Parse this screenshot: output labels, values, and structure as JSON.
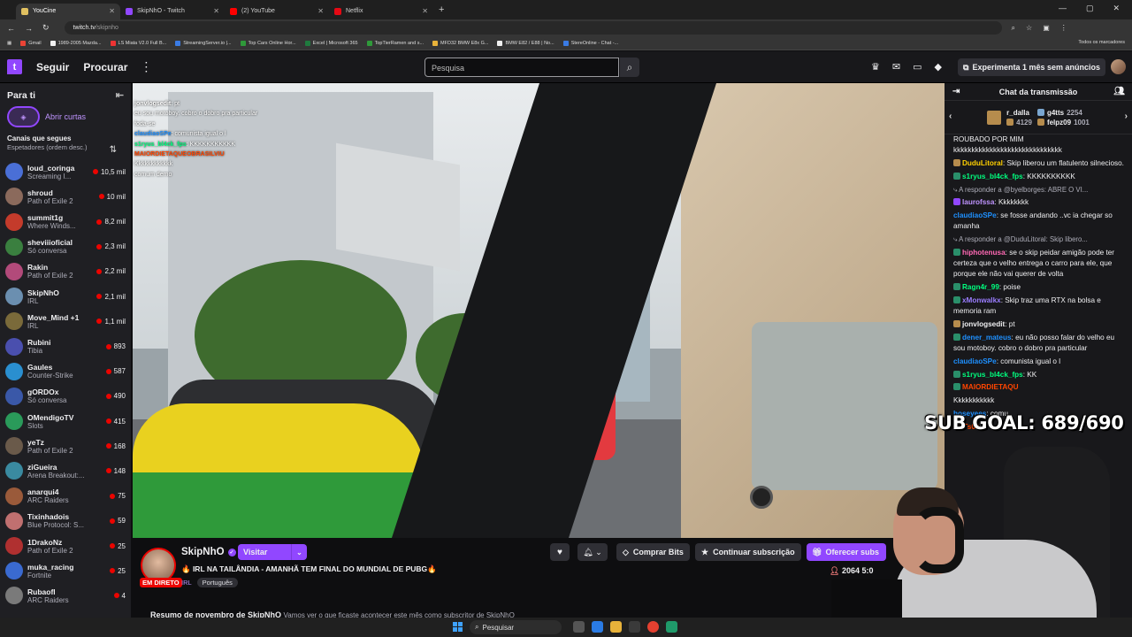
{
  "browser": {
    "tabs": [
      {
        "title": "YouCine",
        "color": "#e0c060",
        "active": true
      },
      {
        "title": "SkipNhO - Twitch",
        "color": "#9147ff",
        "active": false
      },
      {
        "title": "(2) YouTube",
        "color": "#ff0000",
        "active": false
      },
      {
        "title": "Netflix",
        "color": "#e50914",
        "active": false
      }
    ],
    "url_host": "twitch.tv",
    "url_path": "/skipnho",
    "bookmarks": [
      "Gmail",
      "1989-2005 Mazda...",
      "LS Miata V2.0 Full B...",
      "StreamingServer.io |...",
      "Top Cars Online Hor...",
      "Excel | Microsoft 365",
      "TopTierRamen and s...",
      "MFD32 BMW E8x G...",
      "BMW E82 / E88 | No...",
      "StereOnline - Chat -..."
    ],
    "bookmarks_all": "Todos os marcadores"
  },
  "topnav": {
    "follow": "Seguir",
    "browse": "Procurar",
    "search_placeholder": "Pesquisa",
    "promo": "Experimenta 1 mês sem anúncios"
  },
  "sidebar": {
    "title": "Para ti",
    "shorts": "Abrir curtas",
    "section": "Canais que segues",
    "sort": "Espetadores (ordem desc.)",
    "channels": [
      {
        "name": "loud_coringa",
        "game": "Screaming I...",
        "viewers": "10,5 mil",
        "color": "#4a6fd6"
      },
      {
        "name": "shroud",
        "game": "Path of Exile 2",
        "viewers": "10 mil",
        "color": "#8b6a5c"
      },
      {
        "name": "summit1g",
        "game": "Where Winds...",
        "viewers": "8,2 mil",
        "color": "#c43b2b"
      },
      {
        "name": "sheviiioficial",
        "game": "Só conversa",
        "viewers": "2,3 mil",
        "color": "#3a7f3f"
      },
      {
        "name": "Rakin",
        "game": "Path of Exile 2",
        "viewers": "2,2 mil",
        "color": "#b24a7a"
      },
      {
        "name": "SkipNhO",
        "game": "IRL",
        "viewers": "2,1 mil",
        "color": "#6b8fb0"
      },
      {
        "name": "Move_Mind +1",
        "game": "IRL",
        "viewers": "1,1 mil",
        "color": "#7a6a3a"
      },
      {
        "name": "Rubini",
        "game": "Tibia",
        "viewers": "893",
        "color": "#4a4fae"
      },
      {
        "name": "Gaules",
        "game": "Counter-Strike",
        "viewers": "587",
        "color": "#2a8fd0"
      },
      {
        "name": "gORDOx",
        "game": "Só conversa",
        "viewers": "490",
        "color": "#3a58a8"
      },
      {
        "name": "OMendigoTV",
        "game": "Slots",
        "viewers": "415",
        "color": "#2a9a5a"
      },
      {
        "name": "yeTz",
        "game": "Path of Exile 2",
        "viewers": "168",
        "color": "#6a5a4a"
      },
      {
        "name": "ziGueira",
        "game": "Arena Breakout:...",
        "viewers": "148",
        "color": "#3a8aa0"
      },
      {
        "name": "anarqui4",
        "game": "ARC Raiders",
        "viewers": "75",
        "color": "#9a5a3a"
      },
      {
        "name": "Tixinhadois",
        "game": "Blue Protocol: S...",
        "viewers": "59",
        "color": "#c07070"
      },
      {
        "name": "1DrakoNz",
        "game": "Path of Exile 2",
        "viewers": "25",
        "color": "#b03030"
      },
      {
        "name": "muka_racing",
        "game": "Fortnite",
        "viewers": "25",
        "color": "#3a6ad0"
      },
      {
        "name": "Rubaofl",
        "game": "ARC Raiders",
        "viewers": "4",
        "color": "#7a7a7a"
      }
    ]
  },
  "overlay_chat": [
    {
      "user": "jonvlogsedit",
      "text": ": pt"
    },
    {
      "user": "",
      "text": "eu sou motoboy. cobro o dobro pra particular"
    },
    {
      "user": "",
      "text": "foda-se"
    },
    {
      "user": "claudiaoSPe",
      "text": ": comunista igual o l"
    },
    {
      "user": "s1ryus_bl4ck_fps",
      "text": ": KKKKKKKKKKK"
    },
    {
      "user": "MAIORDIETAQUEOBRASILVIU",
      "text": ""
    },
    {
      "user": "",
      "text": "Kkkkkkkkkkkk"
    },
    {
      "user": "",
      "text": "comum demo"
    }
  ],
  "stream": {
    "streamer": "SkipNhO",
    "visit": "Visitar",
    "live": "EM DIRETO",
    "title": "🔥 IRL NA TAILÂNDIA - AMANHÃ TEM FINAL DO MUNDIAL DE PUBG🔥",
    "category": "IRL",
    "tag": "Português",
    "bits": "Comprar Bits",
    "continue_sub": "Continuar subscrição",
    "gift": "Oferecer subs",
    "viewers": "2064",
    "uptime": "5:0",
    "summary_title": "Resumo de novembro de SkipNhO",
    "summary_text": "Vamos ver o que ficaste acontecer este mês como subscritor de SkipNhO"
  },
  "chat": {
    "title": "Chat da transmissão",
    "leaderboard": [
      {
        "name": "r_dalla",
        "score": "4129"
      },
      {
        "name": "g4tts",
        "score": "2254"
      },
      {
        "name": "felpz09",
        "score": "1001"
      }
    ],
    "messages": [
      {
        "user": "",
        "text": "ROUBADO POR MIM kkkkkkkkkkkkkkkkkkkkkkkkkkkkkk",
        "color": "#efeff1",
        "badge": ""
      },
      {
        "user": "DuduLitoral",
        "text": ": Skip liberou um flatulento silnecioso.",
        "color": "#ffd000",
        "badge": "#b68c4d"
      },
      {
        "user": "s1ryus_bl4ck_fps",
        "text": ": KKKKKKKKKK",
        "color": "#00ff7f",
        "badge": "#2a8f6a"
      },
      {
        "reply": "A responder a @byelborges: ABRE O VI..."
      },
      {
        "user": "laurofssa",
        "text": ": Kkkkkkkk",
        "color": "#bf94ff",
        "badge": "#9147ff"
      },
      {
        "user": "claudiaoSPe",
        "text": ": se fosse andando ..vc ia chegar so amanha",
        "color": "#1e90ff",
        "badge": ""
      },
      {
        "reply": "A responder a @DuduLitoral: Skip libero..."
      },
      {
        "user": "hiphotenusa",
        "text": ": se o skip peidar amigão pode ter certeza que o velho entrega o carro para ele, que porque ele não vai querer de volta",
        "color": "#ff69b4",
        "badge": "#2a8f6a"
      },
      {
        "user": "Ragn4r_99",
        "text": ": poise",
        "color": "#00ff7f",
        "badge": "#2a8f6a"
      },
      {
        "user": "xMonwalkx",
        "text": ": Skip traz uma RTX na bolsa e memoria ram",
        "color": "#9a7dff",
        "badge": "#2a8f6a"
      },
      {
        "user": "jonvlogsedit",
        "text": ": pt",
        "color": "#efeff1",
        "badge": "#b68c4d"
      },
      {
        "user": "dener_mateus",
        "text": ": eu não posso falar do velho eu sou motoboy. cobro o dobro pra particular",
        "color": "#1e90ff",
        "badge": "#2a8f6a"
      },
      {
        "user": "claudiaoSPe",
        "text": ": comunista igual o l",
        "color": "#1e90ff",
        "badge": ""
      },
      {
        "user": "s1ryus_bl4ck_fps",
        "text": ": KK",
        "color": "#00ff7f",
        "badge": "#2a8f6a"
      },
      {
        "user": "MAIORDIETAQU",
        "text": "",
        "color": "#ff4500",
        "badge": "#2a8f6a"
      },
      {
        "user": "",
        "text": "Kkkkkkkkkkk",
        "color": "#efeff1",
        "badge": ""
      },
      {
        "user": "hoseyees",
        "text": ": comu",
        "color": "#1e90ff",
        "badge": ""
      },
      {
        "user": "GuTs09",
        "text": ":",
        "color": "#ff4500",
        "badge": ""
      }
    ]
  },
  "sub_goal": "SUB GOAL: 689/690",
  "taskbar": {
    "search": "Pesquisar"
  }
}
